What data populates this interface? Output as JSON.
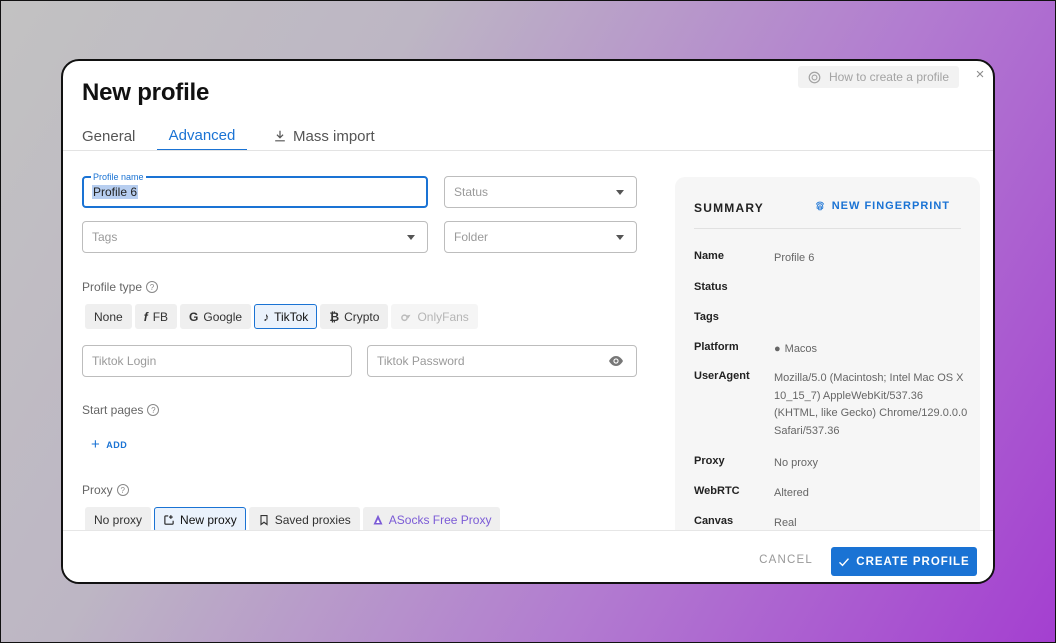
{
  "modal": {
    "title": "New profile",
    "help_link": "How to create a profile",
    "close_glyph": "×"
  },
  "tabs": [
    {
      "label": "General"
    },
    {
      "label": "Advanced"
    },
    {
      "label": "Mass import"
    }
  ],
  "form": {
    "profile_name_label": "Profile name",
    "profile_name_value": "Profile 6",
    "status_placeholder": "Status",
    "tags_placeholder": "Tags",
    "folder_placeholder": "Folder",
    "profile_type_label": "Profile type",
    "profile_types": [
      {
        "label": "None",
        "icon": ""
      },
      {
        "label": "FB",
        "icon": "f"
      },
      {
        "label": "Google",
        "icon": "G"
      },
      {
        "label": "TikTok",
        "icon": "♪"
      },
      {
        "label": "Crypto",
        "icon": "₿"
      },
      {
        "label": "OnlyFans",
        "icon": ""
      }
    ],
    "login_placeholder": "Tiktok Login",
    "password_placeholder": "Tiktok Password",
    "start_pages_label": "Start pages",
    "add_label": "ADD",
    "proxy_label": "Proxy",
    "proxy_options": [
      {
        "label": "No proxy"
      },
      {
        "label": "New proxy"
      },
      {
        "label": "Saved proxies"
      },
      {
        "label": "ASocks Free Proxy"
      }
    ]
  },
  "summary": {
    "title": "SUMMARY",
    "new_fingerprint": "NEW FINGERPRINT",
    "rows": [
      {
        "key": "Name",
        "value": "Profile 6"
      },
      {
        "key": "Status",
        "value": ""
      },
      {
        "key": "Tags",
        "value": ""
      },
      {
        "key": "Platform",
        "value": "Macos"
      },
      {
        "key": "UserAgent",
        "value": "Mozilla/5.0 (Macintosh; Intel Mac OS X 10_15_7) AppleWebKit/537.36 (KHTML, like Gecko) Chrome/129.0.0.0 Safari/537.36"
      },
      {
        "key": "Proxy",
        "value": "No proxy"
      },
      {
        "key": "WebRTC",
        "value": "Altered"
      },
      {
        "key": "Canvas",
        "value": "Real"
      }
    ]
  },
  "footer": {
    "cancel_label": "CANCEL",
    "create_label": "CREATE PROFILE"
  },
  "colors": {
    "accent": "#1a73d4",
    "purple_option": "#7b5bd6"
  },
  "selected": {
    "tab": "Advanced",
    "profile_type": "TikTok",
    "proxy": "New proxy"
  }
}
